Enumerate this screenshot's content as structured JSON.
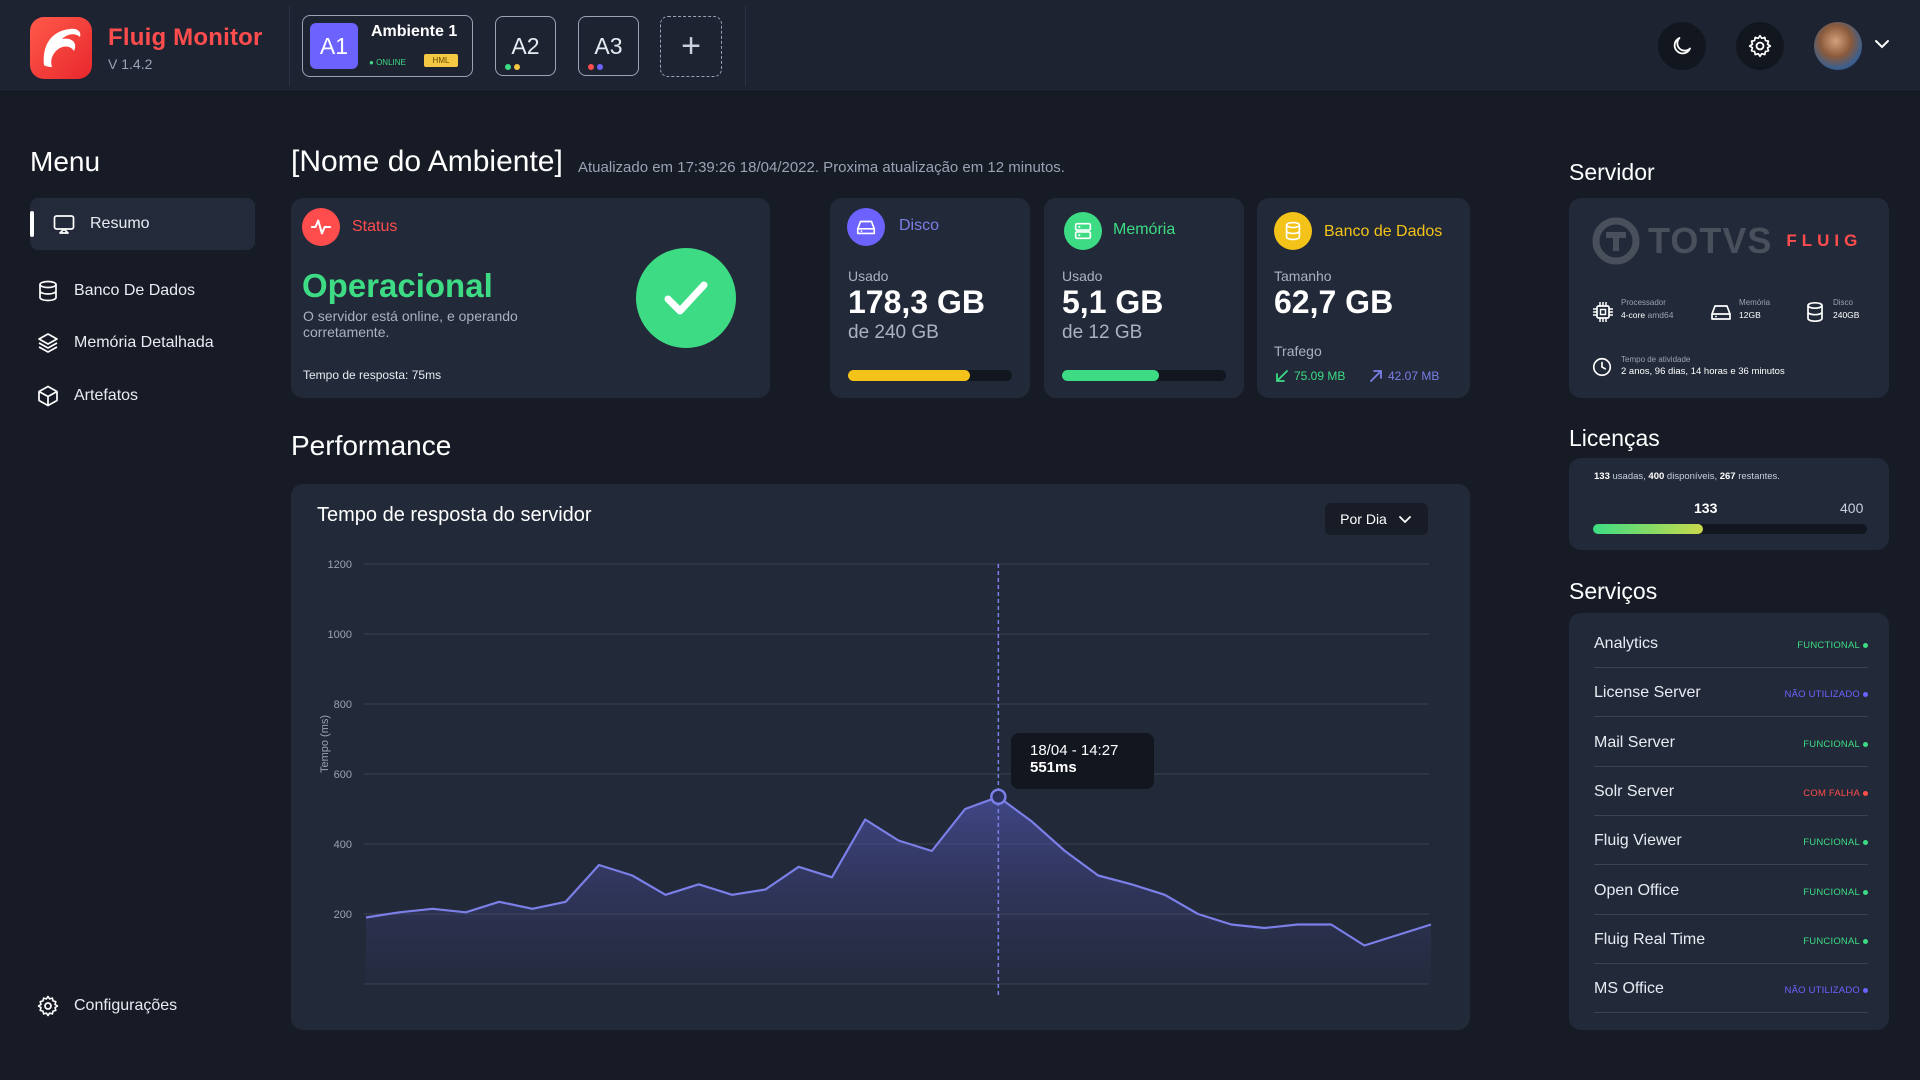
{
  "app": {
    "name": "Fluig Monitor",
    "version": "V 1.4.2"
  },
  "environments": {
    "active": {
      "badge": "A1",
      "name": "Ambiente 1",
      "status": "ONLINE",
      "tag": "HML"
    },
    "others": [
      {
        "label": "A2",
        "dots": [
          "#3ddc84",
          "#f4c842"
        ]
      },
      {
        "label": "A3",
        "dots": [
          "#ff4d4d",
          "#6c63ff"
        ]
      }
    ],
    "add_label": "+"
  },
  "menu": {
    "title": "Menu",
    "items": [
      {
        "label": "Resumo",
        "icon": "monitor-icon",
        "active": true
      },
      {
        "label": "Banco De Dados",
        "icon": "database-icon"
      },
      {
        "label": "Memória Detalhada",
        "icon": "layers-icon"
      },
      {
        "label": "Artefatos",
        "icon": "box-icon"
      }
    ],
    "settings_label": "Configurações"
  },
  "header": {
    "title": "[Nome do Ambiente]",
    "subtitle": "Atualizado em 17:39:26 18/04/2022. Proxima atualização em 12 minutos."
  },
  "status_card": {
    "label": "Status",
    "value": "Operacional",
    "description": "O servidor está online, e operando corretamente.",
    "response": "Tempo de resposta: 75ms"
  },
  "disk_card": {
    "label": "Disco",
    "used_label": "Usado",
    "value": "178,3 GB",
    "total": "de 240 GB",
    "fill": 0.743,
    "color": "#f4c31a"
  },
  "memory_card": {
    "label": "Memória",
    "used_label": "Usado",
    "value": "5,1 GB",
    "total": "de 12 GB",
    "fill": 0.59,
    "color": "#3ddc84"
  },
  "db_card": {
    "label": "Banco de Dados",
    "size_label": "Tamanho",
    "value": "62,7 GB",
    "traffic_label": "Trafego",
    "traffic_in": "75.09 MB",
    "traffic_out": "42.07 MB"
  },
  "performance": {
    "title": "Performance",
    "chart_title": "Tempo de resposta do servidor",
    "period": "Por Dia",
    "tooltip_date": "18/04 - 14:27",
    "tooltip_value": "551ms"
  },
  "chart_data": {
    "type": "area",
    "ylabel": "Tempo (ms)",
    "ylim": [
      0,
      1200
    ],
    "yticks": [
      200,
      400,
      600,
      800,
      1000,
      1200
    ],
    "grid": true,
    "color": "#7b7fe8",
    "highlight_index": 19,
    "values": [
      190,
      205,
      215,
      205,
      235,
      215,
      235,
      340,
      310,
      255,
      285,
      255,
      270,
      335,
      305,
      470,
      410,
      380,
      500,
      535,
      465,
      380,
      310,
      285,
      255,
      200,
      170,
      160,
      170,
      170,
      110,
      140,
      170
    ]
  },
  "server": {
    "title": "Servidor",
    "brand": "TOTVS",
    "brand_sub": "FLUIG",
    "processor_label": "Processador",
    "processor_value": "4-core",
    "processor_arch": "amd64",
    "memory_label": "Memória",
    "memory_value": "12GB",
    "disk_label": "Disco",
    "disk_value": "240GB",
    "uptime_label": "Tempo de atividade",
    "uptime_value": "2 anos, 96 dias, 14 horas e 36 minutos"
  },
  "licenses": {
    "title": "Licenças",
    "used": "133",
    "available": "400",
    "remaining": "267",
    "used_text": "usadas,",
    "available_text": "disponíveis,",
    "remaining_text": "restantes.",
    "fill": 0.4
  },
  "services": {
    "title": "Serviços",
    "items": [
      {
        "name": "Analytics",
        "status": "FUNCTIONAL",
        "color": "#3ddc84"
      },
      {
        "name": "License Server",
        "status": "NÃO UTILIZADO",
        "color": "#6c63ff"
      },
      {
        "name": "Mail Server",
        "status": "FUNCIONAL",
        "color": "#3ddc84"
      },
      {
        "name": "Solr Server",
        "status": "COM FALHA",
        "color": "#ff4d4d"
      },
      {
        "name": "Fluig Viewer",
        "status": "FUNCIONAL",
        "color": "#3ddc84"
      },
      {
        "name": "Open Office",
        "status": "FUNCIONAL",
        "color": "#3ddc84"
      },
      {
        "name": "Fluig Real Time",
        "status": "FUNCIONAL",
        "color": "#3ddc84"
      },
      {
        "name": "MS Office",
        "status": "NÃO UTILIZADO",
        "color": "#6c63ff"
      }
    ]
  }
}
